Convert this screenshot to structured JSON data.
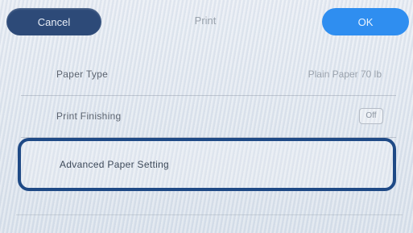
{
  "header": {
    "cancel_label": "Cancel",
    "title": "Print",
    "ok_label": "OK"
  },
  "settings": {
    "items": [
      {
        "label": "Paper Type",
        "value": "Plain Paper 70 lb"
      },
      {
        "label": "Print Finishing",
        "value": "Off"
      },
      {
        "label": "Advanced Paper Setting",
        "value": ""
      }
    ]
  },
  "colors": {
    "cancel_button": "#2d4a78",
    "ok_button": "#2f8ef0",
    "highlight_outline": "#1f4a86"
  }
}
